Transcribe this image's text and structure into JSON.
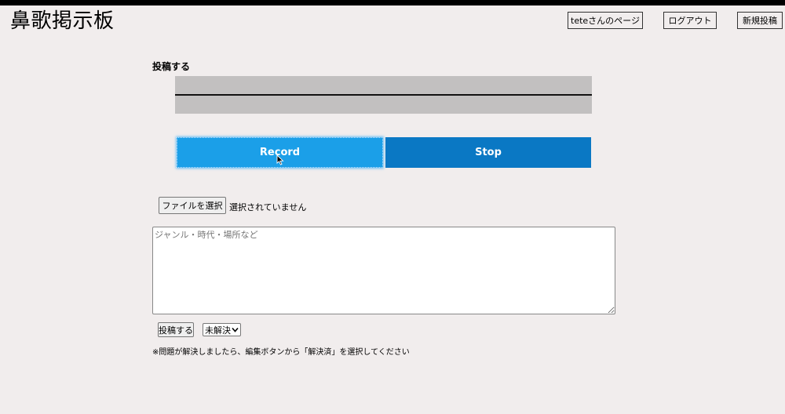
{
  "header": {
    "site_title": "鼻歌掲示板",
    "nav": {
      "my_page": "teteさんのページ",
      "logout": "ログアウト",
      "new_post": "新規投稿"
    }
  },
  "post_form": {
    "heading": "投稿する",
    "record_label": "Record",
    "stop_label": "Stop",
    "file_button_label": "ファイルを選択",
    "file_status": "選択されていません",
    "comment_placeholder": "ジャンル・時代・場所など",
    "submit_label": "投稿する",
    "status_selected": "未解決",
    "note": "※問題が解決しましたら、編集ボタンから「解決済」を選択してください"
  },
  "colors": {
    "background": "#f1eded",
    "record_button": "#1b9fe8",
    "stop_button": "#0a78c4",
    "waveform_bg": "#c2c0c0"
  }
}
